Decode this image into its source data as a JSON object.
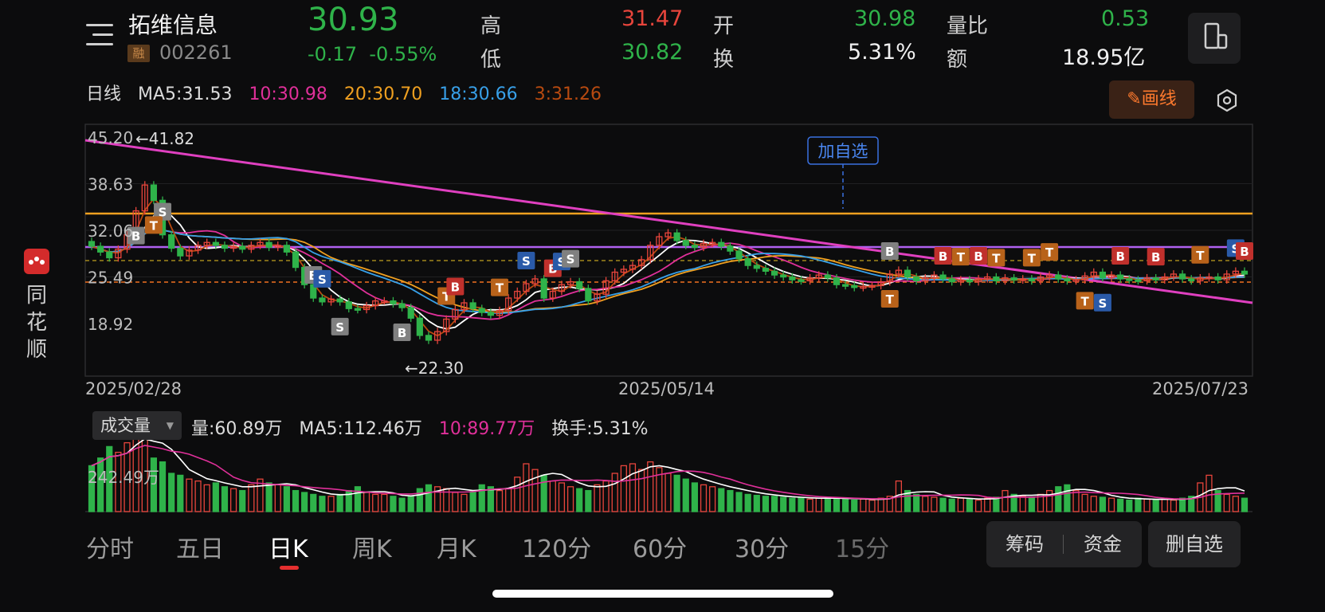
{
  "stock": {
    "name": "拓维信息",
    "margin_badge": "融",
    "code": "002261",
    "price": "30.93",
    "change": "-0.17",
    "change_pct": "-0.55%"
  },
  "quote": {
    "high_label": "高",
    "high": "31.47",
    "low_label": "低",
    "low": "30.82",
    "open_label": "开",
    "open": "30.98",
    "turnover_label": "换",
    "turnover": "5.31%",
    "vol_ratio_label": "量比",
    "vol_ratio": "0.53",
    "amount_label": "额",
    "amount": "18.95亿"
  },
  "ma_legend": {
    "period": "日线",
    "ma5": "MA5:31.53",
    "ma10": "10:30.98",
    "ma20": "20:30.70",
    "ma18": "18:30.66",
    "ma3": "3:31.26"
  },
  "toolbar": {
    "draw_label": "画线"
  },
  "colors": {
    "up": "#e8453c",
    "down": "#2fb34a",
    "ma5": "#ffffff",
    "ma10": "#e0309a",
    "ma20": "#f0a020",
    "ma30": "#38a0e8",
    "ma60": "#b84a10",
    "trend": "#e040c0",
    "orange_line": "#f0a020",
    "purple_line": "#b060f0"
  },
  "chart_data": [
    {
      "type": "candlestick",
      "y_ticks": [
        "45.20",
        "38.63",
        "32.06",
        "25.49",
        "18.92"
      ],
      "ylim": [
        18.92,
        45.2
      ],
      "x_labels": [
        "2025/02/28",
        "2025/05/14",
        "2025/07/23"
      ],
      "annotations": {
        "max": "←41.82",
        "min": "←22.30",
        "add_watch": "加自选"
      }
    },
    {
      "type": "bar",
      "selector_label": "成交量",
      "volume": "量:60.89万",
      "ma5": "MA5:112.46万",
      "ma10": "10:89.77万",
      "turnover": "换手:5.31%",
      "axis_label": "242.49万"
    }
  ],
  "tabs": [
    "分时",
    "五日",
    "日K",
    "周K",
    "月K",
    "120分",
    "60分",
    "30分",
    "15分"
  ],
  "buttons": {
    "chips": "筹码",
    "funds": "资金",
    "remove_watch": "删自选"
  },
  "sidebar": {
    "brand": [
      "同",
      "花",
      "顺"
    ]
  }
}
